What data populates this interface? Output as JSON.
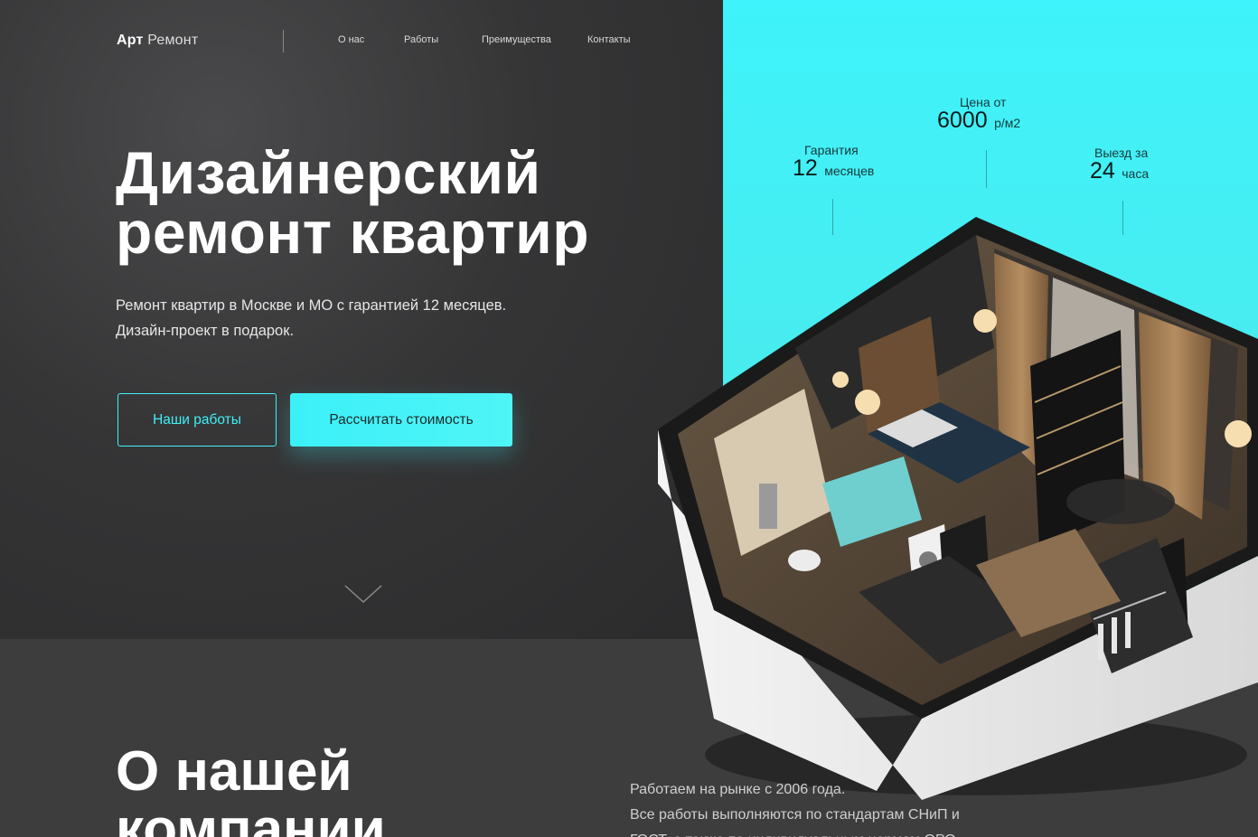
{
  "header": {
    "logo_bold": "Арт",
    "logo_thin": "Ремонт",
    "nav": [
      "О нас",
      "Работы",
      "Преимущества",
      "Контакты"
    ]
  },
  "hero": {
    "title_line1": "Дизайнерский",
    "title_line2": "ремонт квартир",
    "subtitle_line1": "Ремонт квартир в Москве и МО с гарантией 12 месяцев.",
    "subtitle_line2": "Дизайн-проект в подарок.",
    "btn_works": "Наши работы",
    "btn_calc": "Рассчитать стоимость"
  },
  "stats": {
    "guarantee": {
      "label": "Гарантия",
      "value": "12",
      "unit": "месяцев"
    },
    "price": {
      "label": "Цена от",
      "value": "6000",
      "unit": "р/м2"
    },
    "visit": {
      "label": "Выезд за",
      "value": "24",
      "unit": "часа"
    }
  },
  "about": {
    "title_line1": "О нашей",
    "title_line2": "компании",
    "text_line1": "Работаем на рынке с 2006 года.",
    "text_line2": "Все работы выполняются по стандартам СНиП и",
    "text_line3": "ГОСТ, а также по индивидуальным нормам ОРО"
  },
  "colors": {
    "accent": "#3ff0f6",
    "dark": "#2f2f30",
    "cyan_bg": "#45eff3"
  }
}
